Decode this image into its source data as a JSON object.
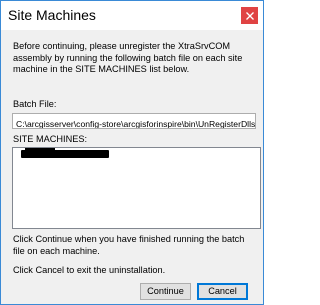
{
  "window": {
    "title": "Site Machines",
    "close_icon": "close-icon",
    "close_color": "#e04343"
  },
  "intro_text": "Before continuing, please unregister the XtraSrvCOM assembly by running the following batch file on each site machine in the SITE MACHINES list below.",
  "batch": {
    "label": "Batch File:",
    "value": "C:\\arcgisserver\\config-store\\arcgisforinspire\\bin\\UnRegisterDlls"
  },
  "site_machines": {
    "label": "SITE MACHINES:",
    "items": [
      ""
    ]
  },
  "continue_text": "Click Continue when you have finished running the batch file on each machine.",
  "cancel_text": "Click Cancel to exit the uninstallation.",
  "buttons": {
    "continue_label": "Continue",
    "cancel_label": "Cancel"
  }
}
